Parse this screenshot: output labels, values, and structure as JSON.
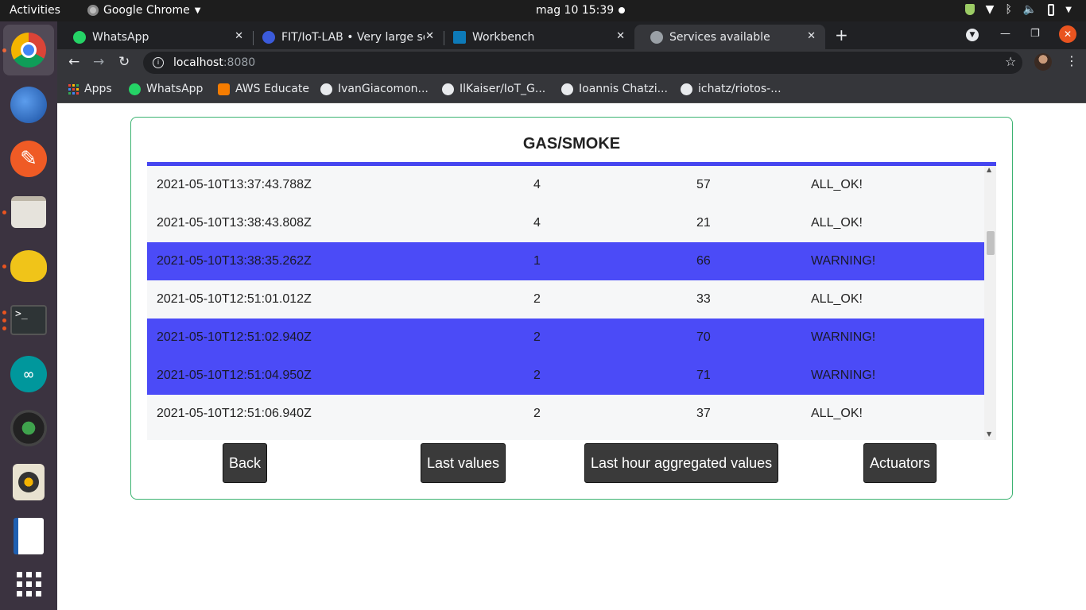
{
  "topbar": {
    "activities": "Activities",
    "app_name": "Google Chrome",
    "clock": "mag 10  15:39"
  },
  "dock": {
    "items": [
      "chrome-icon",
      "thunderbird-icon",
      "postman-icon",
      "files-icon",
      "teapot-icon",
      "terminal-icon",
      "arduino-icon",
      "camera-icon",
      "rhythmbox-icon",
      "libreoffice-impress-icon",
      "show-apps-icon"
    ]
  },
  "tabs": [
    {
      "label": "WhatsApp",
      "close": "✕",
      "color": "#25d366"
    },
    {
      "label": "FIT/IoT-LAB • Very large sc",
      "close": "✕",
      "color": "#3b5bdb"
    },
    {
      "label": "Workbench",
      "close": "✕",
      "color": "#0d7ab8"
    },
    {
      "label": "Services available",
      "close": "✕",
      "color": "#9aa0a6"
    }
  ],
  "toolbar": {
    "url_host": "localhost",
    "url_port": ":8080"
  },
  "bookmarks": [
    {
      "label": "Apps"
    },
    {
      "label": "WhatsApp",
      "color": "#25d366"
    },
    {
      "label": "AWS Educate",
      "color": "#f57c00"
    },
    {
      "label": "IvanGiacomon...",
      "color": "#e8eaed"
    },
    {
      "label": "IlKaiser/IoT_G...",
      "color": "#e8eaed"
    },
    {
      "label": "Ioannis Chatzi...",
      "color": "#e8eaed"
    },
    {
      "label": "ichatz/riotos-...",
      "color": "#e8eaed"
    }
  ],
  "panel": {
    "title": "GAS/SMOKE",
    "rows": [
      {
        "timestamp": "2021-05-10T13:37:43.788Z",
        "a": "4",
        "b": "57",
        "status": "ALL_OK!",
        "warning": false
      },
      {
        "timestamp": "2021-05-10T13:38:43.808Z",
        "a": "4",
        "b": "21",
        "status": "ALL_OK!",
        "warning": false
      },
      {
        "timestamp": "2021-05-10T13:38:35.262Z",
        "a": "1",
        "b": "66",
        "status": "WARNING!",
        "warning": true
      },
      {
        "timestamp": "2021-05-10T12:51:01.012Z",
        "a": "2",
        "b": "33",
        "status": "ALL_OK!",
        "warning": false
      },
      {
        "timestamp": "2021-05-10T12:51:02.940Z",
        "a": "2",
        "b": "70",
        "status": "WARNING!",
        "warning": true
      },
      {
        "timestamp": "2021-05-10T12:51:04.950Z",
        "a": "2",
        "b": "71",
        "status": "WARNING!",
        "warning": true
      },
      {
        "timestamp": "2021-05-10T12:51:06.940Z",
        "a": "2",
        "b": "37",
        "status": "ALL_OK!",
        "warning": false
      },
      {
        "timestamp": "",
        "a": "",
        "b": "",
        "status": "",
        "warning": false
      }
    ],
    "buttons": {
      "back": "Back",
      "last_values": "Last values",
      "last_hour": "Last hour aggregated values",
      "actuators": "Actuators"
    }
  },
  "colors": {
    "warning_row": "#4b4bf7",
    "header_bar": "#4646f0",
    "panel_border": "#3cb371",
    "button_bg": "#3a3a3a"
  }
}
